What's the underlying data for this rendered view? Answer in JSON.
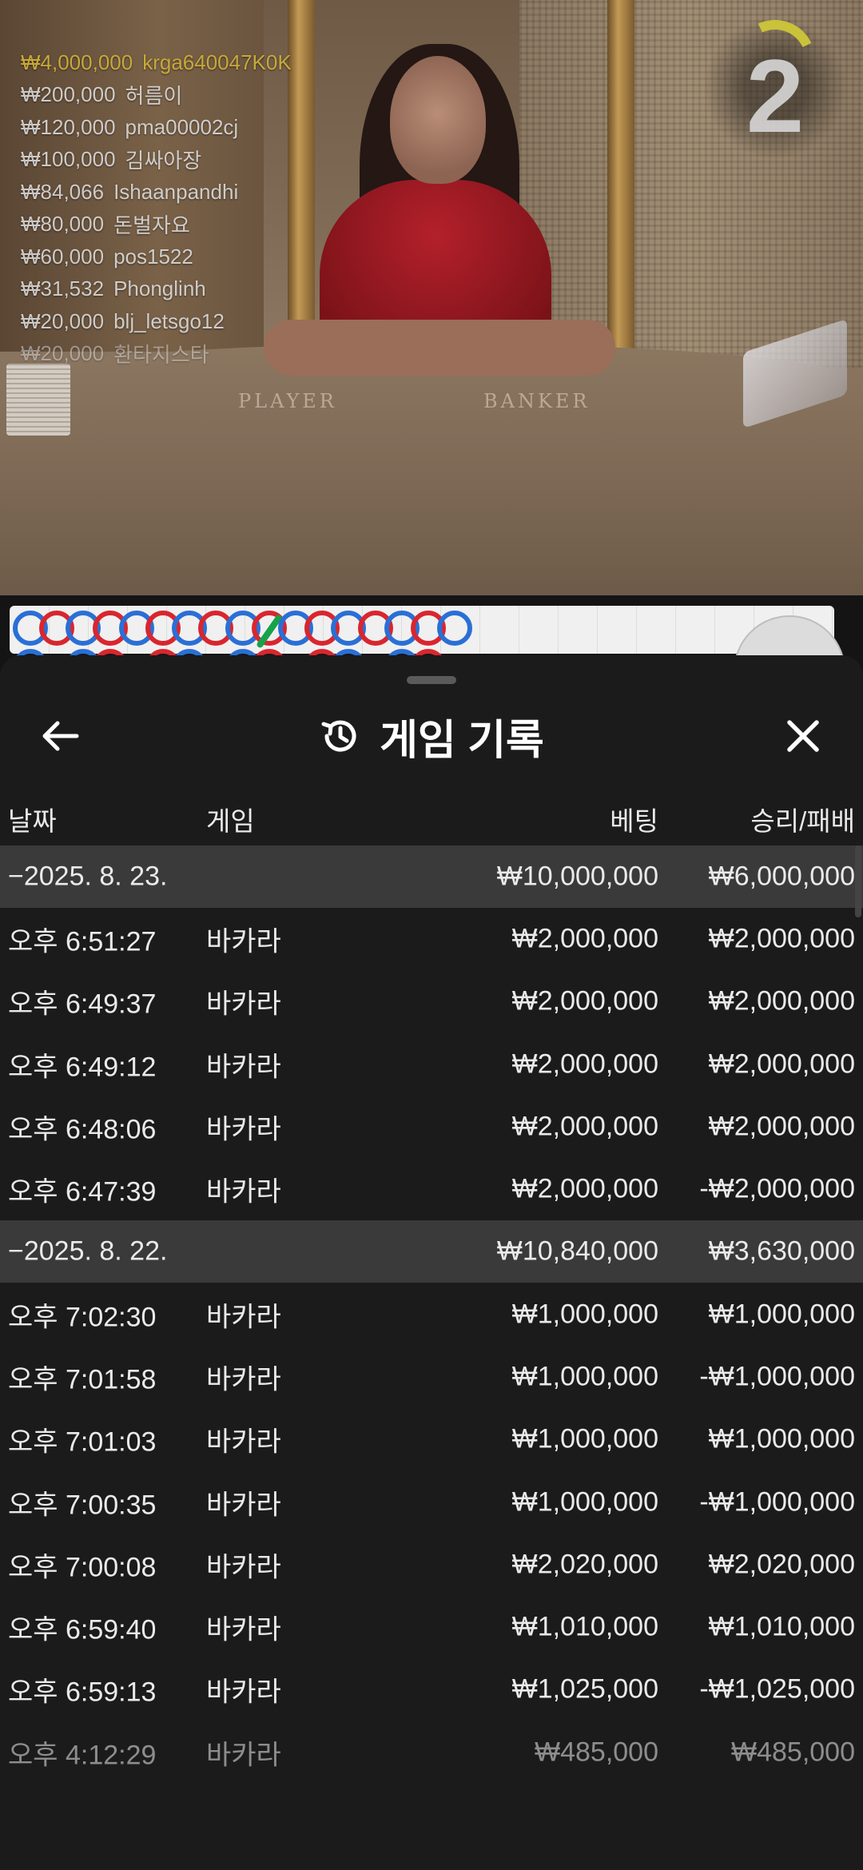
{
  "leaderboard": [
    {
      "amount": "₩4,000,000",
      "user": "krga640047K0K"
    },
    {
      "amount": "₩200,000",
      "user": "허름이"
    },
    {
      "amount": "₩120,000",
      "user": "pma00002cj"
    },
    {
      "amount": "₩100,000",
      "user": "김싸아장"
    },
    {
      "amount": "₩84,066",
      "user": "Ishaanpandhi"
    },
    {
      "amount": "₩80,000",
      "user": "돈벌자요"
    },
    {
      "amount": "₩60,000",
      "user": "pos1522"
    },
    {
      "amount": "₩31,532",
      "user": "Phonglinh"
    },
    {
      "amount": "₩20,000",
      "user": "blj_letsgo12"
    },
    {
      "amount": "₩20,000",
      "user": "환타지스타"
    }
  ],
  "video": {
    "player_label": "PLAYER",
    "banker_label": "BANKER"
  },
  "countdown": "2",
  "colors": {
    "player": "#2a6fd6",
    "banker": "#d9262e",
    "tie": "#16a34a",
    "timer": "#c9c23a"
  },
  "bead_road": [
    "player",
    "banker",
    "player",
    "banker",
    "player",
    "banker",
    "player",
    "banker",
    "player",
    "tie",
    "player",
    "banker",
    "player",
    "banker",
    "player",
    "banker",
    "player"
  ],
  "sheet": {
    "title": "게임 기록",
    "title_icon": "history-icon",
    "back_icon": "arrow-left-icon",
    "close_icon": "close-icon",
    "columns": {
      "date": "날짜",
      "game": "게임",
      "bet": "베팅",
      "win": "승리/패배"
    },
    "rows": [
      {
        "type": "date",
        "date": "−2025. 8. 23.",
        "bet": "₩10,000,000",
        "win": "₩6,000,000"
      },
      {
        "type": "game",
        "time": "오후 6:51:27",
        "game": "바카라",
        "bet": "₩2,000,000",
        "win": "₩2,000,000"
      },
      {
        "type": "game",
        "time": "오후 6:49:37",
        "game": "바카라",
        "bet": "₩2,000,000",
        "win": "₩2,000,000"
      },
      {
        "type": "game",
        "time": "오후 6:49:12",
        "game": "바카라",
        "bet": "₩2,000,000",
        "win": "₩2,000,000"
      },
      {
        "type": "game",
        "time": "오후 6:48:06",
        "game": "바카라",
        "bet": "₩2,000,000",
        "win": "₩2,000,000"
      },
      {
        "type": "game",
        "time": "오후 6:47:39",
        "game": "바카라",
        "bet": "₩2,000,000",
        "win": "-₩2,000,000"
      },
      {
        "type": "date",
        "date": "−2025. 8. 22.",
        "bet": "₩10,840,000",
        "win": "₩3,630,000"
      },
      {
        "type": "game",
        "time": "오후 7:02:30",
        "game": "바카라",
        "bet": "₩1,000,000",
        "win": "₩1,000,000"
      },
      {
        "type": "game",
        "time": "오후 7:01:58",
        "game": "바카라",
        "bet": "₩1,000,000",
        "win": "-₩1,000,000"
      },
      {
        "type": "game",
        "time": "오후 7:01:03",
        "game": "바카라",
        "bet": "₩1,000,000",
        "win": "₩1,000,000"
      },
      {
        "type": "game",
        "time": "오후 7:00:35",
        "game": "바카라",
        "bet": "₩1,000,000",
        "win": "-₩1,000,000"
      },
      {
        "type": "game",
        "time": "오후 7:00:08",
        "game": "바카라",
        "bet": "₩2,020,000",
        "win": "₩2,020,000"
      },
      {
        "type": "game",
        "time": "오후 6:59:40",
        "game": "바카라",
        "bet": "₩1,010,000",
        "win": "₩1,010,000"
      },
      {
        "type": "game",
        "time": "오후 6:59:13",
        "game": "바카라",
        "bet": "₩1,025,000",
        "win": "-₩1,025,000"
      },
      {
        "type": "game",
        "time": "오후 4:12:29",
        "game": "바카라",
        "bet": "₩485,000",
        "win": "₩485,000",
        "fade": "dim"
      }
    ]
  }
}
